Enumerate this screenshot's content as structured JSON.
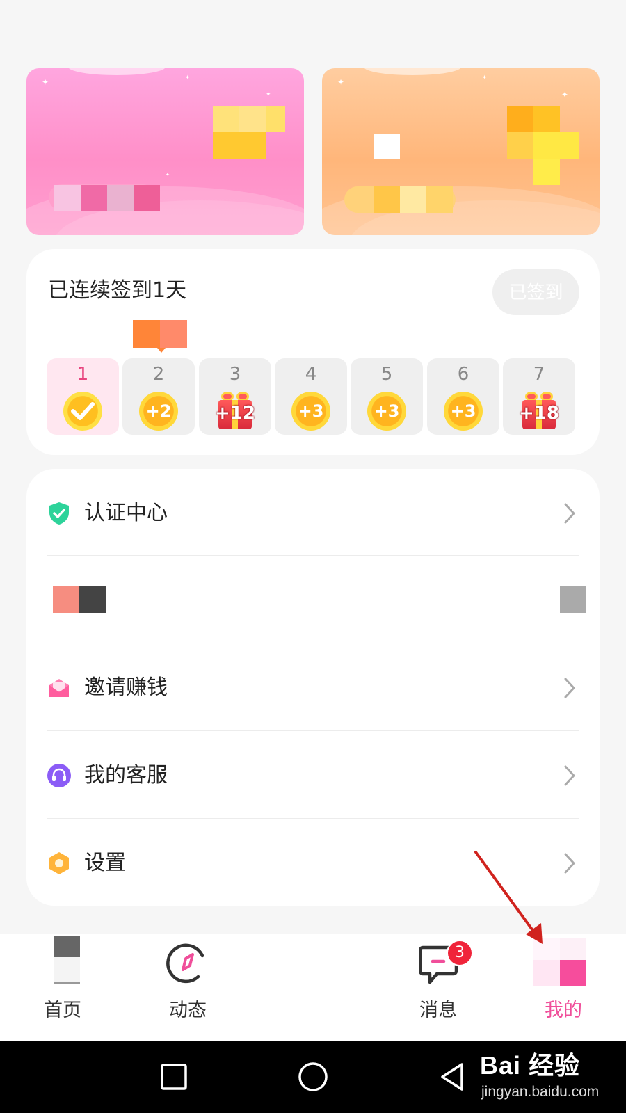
{
  "checkin": {
    "title": "已连续签到1天",
    "signed_label": "已签到",
    "days": [
      {
        "num": "1",
        "reward": "",
        "type": "checked"
      },
      {
        "num": "2",
        "reward": "+2",
        "type": "coin"
      },
      {
        "num": "3",
        "reward": "+12",
        "type": "gift"
      },
      {
        "num": "4",
        "reward": "+3",
        "type": "coin"
      },
      {
        "num": "5",
        "reward": "+3",
        "type": "coin"
      },
      {
        "num": "6",
        "reward": "+3",
        "type": "coin"
      },
      {
        "num": "7",
        "reward": "+18",
        "type": "gift"
      }
    ]
  },
  "menu": {
    "items": [
      {
        "label": "认证中心",
        "icon": "shield-check-icon"
      },
      {
        "label": "",
        "icon": "redacted"
      },
      {
        "label": "邀请赚钱",
        "icon": "envelope-icon"
      },
      {
        "label": "我的客服",
        "icon": "headset-icon"
      },
      {
        "label": "设置",
        "icon": "gear-icon"
      }
    ]
  },
  "bottom_nav": {
    "items": [
      {
        "label": "首页",
        "icon": "home-icon"
      },
      {
        "label": "动态",
        "icon": "compass-icon"
      },
      {
        "label": "消息",
        "icon": "message-icon",
        "badge": "3"
      },
      {
        "label": "我的",
        "icon": "profile-icon",
        "active": true
      }
    ]
  },
  "watermark": {
    "logo": "Bai 经验",
    "url": "jingyan.baidu.com"
  },
  "colors": {
    "accent": "#f04e9a",
    "badge": "#f0243a",
    "coin": "#ffb41f",
    "pink_banner": "#ff8fc8",
    "orange_banner": "#ffb67a"
  }
}
